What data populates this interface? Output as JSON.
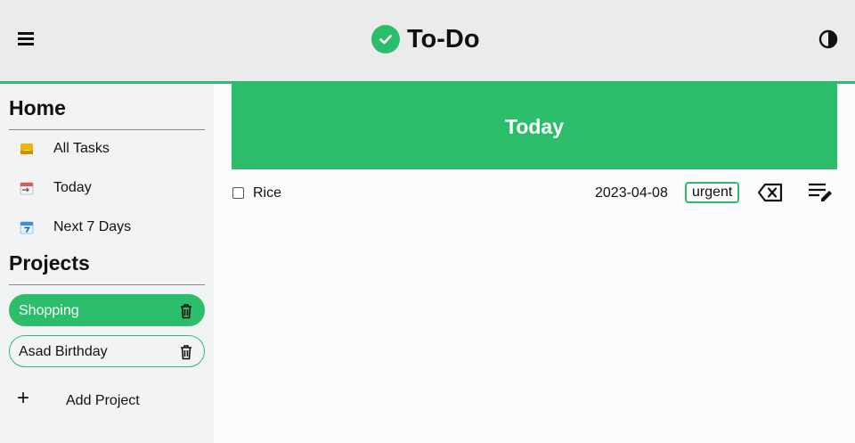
{
  "header": {
    "menu_icon": "hamburger-menu-icon",
    "brand_icon": "check-circle-icon",
    "title": "To-Do",
    "theme_icon": "contrast-toggle-icon",
    "accent_color": "#2bbd6a"
  },
  "sidebar": {
    "home_title": "Home",
    "nav_items": [
      {
        "label": "All Tasks",
        "icon": "inbox-icon"
      },
      {
        "label": "Today",
        "icon": "calendar-today-icon"
      },
      {
        "label": "Next 7 Days",
        "icon": "calendar-7-icon"
      }
    ],
    "projects_title": "Projects",
    "projects": [
      {
        "label": "Shopping",
        "active": true
      },
      {
        "label": "Asad Birthday",
        "active": false
      }
    ],
    "add_project_label": "Add Project"
  },
  "main": {
    "view_title": "Today",
    "tasks": [
      {
        "name": "Rice",
        "date": "2023-04-08",
        "tag": "urgent",
        "completed": false
      }
    ]
  }
}
